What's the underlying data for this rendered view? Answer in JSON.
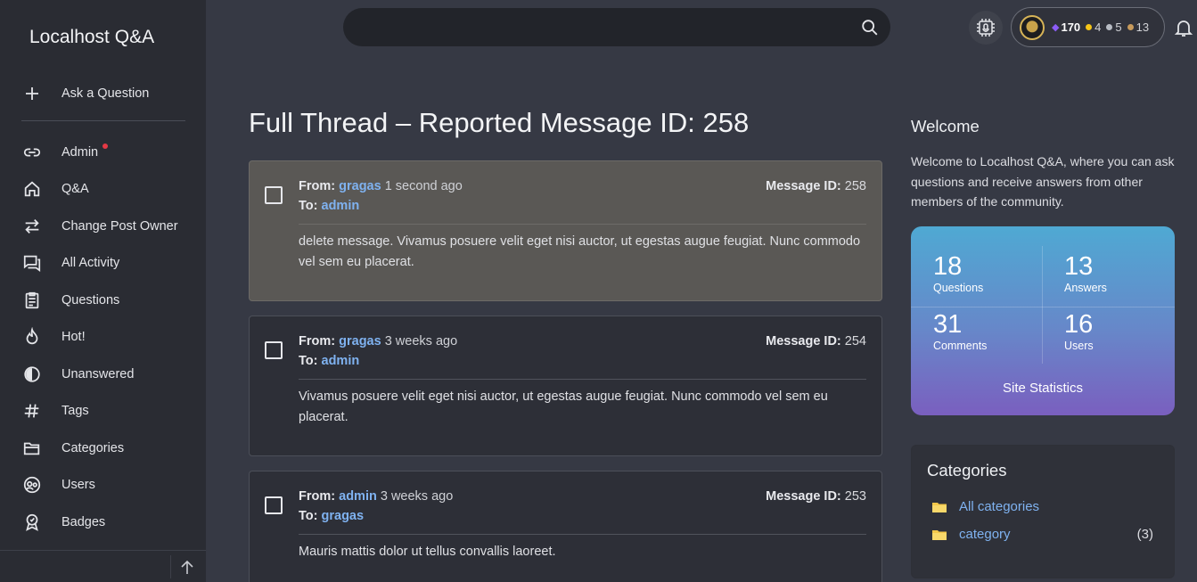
{
  "app": {
    "brand": "Localhost Q&A"
  },
  "sidebar": {
    "ask_label": "Ask a Question",
    "items": [
      {
        "label": "Admin",
        "icon": "link-icon",
        "has_dot": true
      },
      {
        "label": "Q&A",
        "icon": "home-icon"
      },
      {
        "label": "Change Post Owner",
        "icon": "swap-arrows-icon"
      },
      {
        "label": "All Activity",
        "icon": "chat-icon"
      },
      {
        "label": "Questions",
        "icon": "clipboard-icon"
      },
      {
        "label": "Hot!",
        "icon": "flame-icon"
      },
      {
        "label": "Unanswered",
        "icon": "half-circle-icon"
      },
      {
        "label": "Tags",
        "icon": "hash-icon"
      },
      {
        "label": "Categories",
        "icon": "folder-icon"
      },
      {
        "label": "Users",
        "icon": "users-icon"
      },
      {
        "label": "Badges",
        "icon": "badge-icon"
      }
    ]
  },
  "topbar": {
    "search_placeholder": "",
    "points": "170",
    "gold": "4",
    "silver": "5",
    "bronze": "13"
  },
  "main": {
    "title": "Full Thread – Reported Message ID: 258",
    "from_label": "From:",
    "to_label": "To:",
    "id_label": "Message ID:",
    "messages": [
      {
        "from": "gragas",
        "time": "1 second ago",
        "to": "admin",
        "id": "258",
        "body": "delete message. Vivamus posuere velit eget nisi auctor, ut egestas augue feugiat. Nunc commodo vel sem eu placerat."
      },
      {
        "from": "gragas",
        "time": "3 weeks ago",
        "to": "admin",
        "id": "254",
        "body": "Vivamus posuere velit eget nisi auctor, ut egestas augue feugiat. Nunc commodo vel sem eu placerat."
      },
      {
        "from": "admin",
        "time": "3 weeks ago",
        "to": "gragas",
        "id": "253",
        "body": "Mauris mattis dolor ut tellus convallis laoreet."
      }
    ]
  },
  "right": {
    "welcome_title": "Welcome",
    "welcome_text": "Welcome to Localhost Q&A, where you can ask questions and receive answers from other members of the community.",
    "stats": {
      "questions": {
        "num": "18",
        "label": "Questions"
      },
      "answers": {
        "num": "13",
        "label": "Answers"
      },
      "comments": {
        "num": "31",
        "label": "Comments"
      },
      "users": {
        "num": "16",
        "label": "Users"
      },
      "footer": "Site Statistics"
    },
    "categories": {
      "title": "Categories",
      "items": [
        {
          "label": "All categories",
          "count": ""
        },
        {
          "label": "category",
          "count": "(3)"
        }
      ]
    }
  },
  "colors": {
    "accent_link": "#7fb2f0",
    "stats_gradient_top": "#4fa9d3",
    "stats_gradient_bottom": "#7a5fbf",
    "notify_dot": "#e53945"
  }
}
